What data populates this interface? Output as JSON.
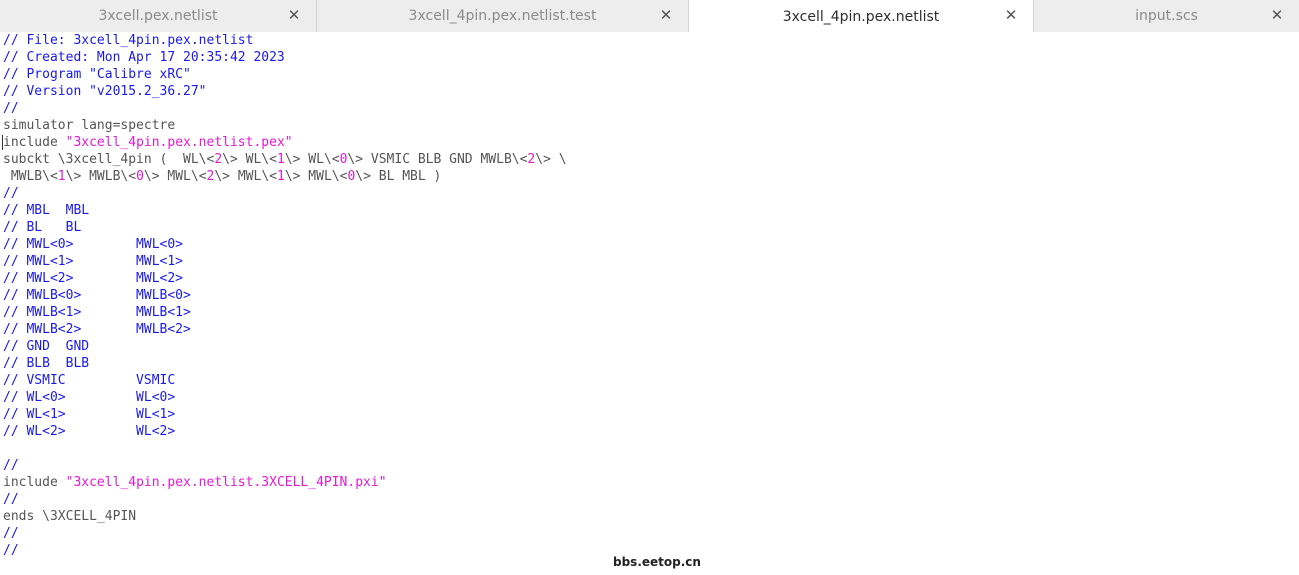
{
  "colors": {
    "comment": "#1a1aee",
    "string": "#e619d6",
    "number": "#e619d6",
    "plain": "#555555"
  },
  "tabs": [
    {
      "name": "tab-3xcell-pex-netlist",
      "label": "3xcell.pex.netlist",
      "close_icon": "close-icon",
      "active": false
    },
    {
      "name": "tab-3xcell-4pin-pex-netlist-test",
      "label": "3xcell_4pin.pex.netlist.test",
      "close_icon": "close-icon",
      "active": false
    },
    {
      "name": "tab-3xcell-4pin-pex-netlist",
      "label": "3xcell_4pin.pex.netlist",
      "close_icon": "close-icon",
      "active": true
    },
    {
      "name": "tab-input-scs",
      "label": "input.scs",
      "close_icon": "close-icon",
      "active": false
    }
  ],
  "code_lines": [
    [
      {
        "t": "// File: 3xcell_4pin.pex.netlist",
        "c": "comment"
      }
    ],
    [
      {
        "t": "// Created: Mon Apr 17 20:35:42 2023",
        "c": "comment"
      }
    ],
    [
      {
        "t": "// Program \"Calibre xRC\"",
        "c": "comment"
      }
    ],
    [
      {
        "t": "// Version \"v2015.2_36.27\"",
        "c": "comment"
      }
    ],
    [
      {
        "t": "//",
        "c": "comment"
      }
    ],
    [
      {
        "t": "simulator lang=spectre",
        "c": "plain"
      }
    ],
    [
      {
        "t": "include ",
        "c": "plain"
      },
      {
        "t": "\"3xcell_4pin.pex.netlist.pex\"",
        "c": "string"
      }
    ],
    [
      {
        "t": "subckt \\3xcell_4pin (  WL\\<",
        "c": "plain"
      },
      {
        "t": "2",
        "c": "number"
      },
      {
        "t": "\\> WL\\<",
        "c": "plain"
      },
      {
        "t": "1",
        "c": "number"
      },
      {
        "t": "\\> WL\\<",
        "c": "plain"
      },
      {
        "t": "0",
        "c": "number"
      },
      {
        "t": "\\> VSMIC BLB GND MWLB\\<",
        "c": "plain"
      },
      {
        "t": "2",
        "c": "number"
      },
      {
        "t": "\\> \\",
        "c": "plain"
      }
    ],
    [
      {
        "t": " MWLB\\<",
        "c": "plain"
      },
      {
        "t": "1",
        "c": "number"
      },
      {
        "t": "\\> MWLB\\<",
        "c": "plain"
      },
      {
        "t": "0",
        "c": "number"
      },
      {
        "t": "\\> MWL\\<",
        "c": "plain"
      },
      {
        "t": "2",
        "c": "number"
      },
      {
        "t": "\\> MWL\\<",
        "c": "plain"
      },
      {
        "t": "1",
        "c": "number"
      },
      {
        "t": "\\> MWL\\<",
        "c": "plain"
      },
      {
        "t": "0",
        "c": "number"
      },
      {
        "t": "\\> BL MBL )",
        "c": "plain"
      }
    ],
    [
      {
        "t": "//",
        "c": "comment"
      }
    ],
    [
      {
        "t": "// MBL  MBL",
        "c": "comment"
      }
    ],
    [
      {
        "t": "// BL   BL",
        "c": "comment"
      }
    ],
    [
      {
        "t": "// MWL<0>        MWL<0>",
        "c": "comment"
      }
    ],
    [
      {
        "t": "// MWL<1>        MWL<1>",
        "c": "comment"
      }
    ],
    [
      {
        "t": "// MWL<2>        MWL<2>",
        "c": "comment"
      }
    ],
    [
      {
        "t": "// MWLB<0>       MWLB<0>",
        "c": "comment"
      }
    ],
    [
      {
        "t": "// MWLB<1>       MWLB<1>",
        "c": "comment"
      }
    ],
    [
      {
        "t": "// MWLB<2>       MWLB<2>",
        "c": "comment"
      }
    ],
    [
      {
        "t": "// GND  GND",
        "c": "comment"
      }
    ],
    [
      {
        "t": "// BLB  BLB",
        "c": "comment"
      }
    ],
    [
      {
        "t": "// VSMIC         VSMIC",
        "c": "comment"
      }
    ],
    [
      {
        "t": "// WL<0>         WL<0>",
        "c": "comment"
      }
    ],
    [
      {
        "t": "// WL<1>         WL<1>",
        "c": "comment"
      }
    ],
    [
      {
        "t": "// WL<2>         WL<2>",
        "c": "comment"
      }
    ],
    [],
    [
      {
        "t": "//",
        "c": "comment"
      }
    ],
    [
      {
        "t": "include ",
        "c": "plain"
      },
      {
        "t": "\"3xcell_4pin.pex.netlist.3XCELL_4PIN.pxi\"",
        "c": "string"
      }
    ],
    [
      {
        "t": "//",
        "c": "comment"
      }
    ],
    [
      {
        "t": "ends \\3XCELL_4PIN",
        "c": "plain"
      }
    ],
    [
      {
        "t": "//",
        "c": "comment"
      }
    ],
    [
      {
        "t": "//",
        "c": "comment"
      }
    ]
  ],
  "watermark": "bbs.eetop.cn"
}
